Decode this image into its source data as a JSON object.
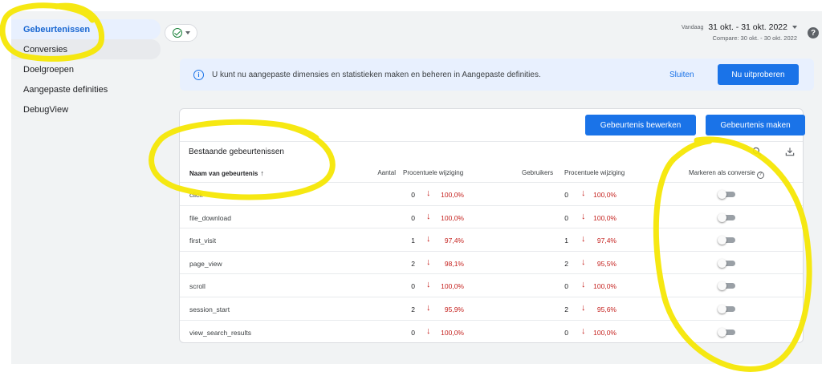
{
  "sidebar": {
    "items": [
      {
        "label": "Gebeurtenissen",
        "active": true
      },
      {
        "label": "Conversies"
      },
      {
        "label": "Doelgroepen"
      },
      {
        "label": "Aangepaste definities"
      },
      {
        "label": "DebugView"
      }
    ]
  },
  "header": {
    "status_icon": "check-circle-icon",
    "date_label": "Vandaag",
    "date_range": "31 okt. - 31 okt. 2022",
    "compare": "Compare: 30 okt. - 30 okt. 2022",
    "help": "?"
  },
  "banner": {
    "icon": "i",
    "text": "U kunt nu aangepaste dimensies en statistieken maken en beheren in Aangepaste definities.",
    "close_label": "Sluiten",
    "try_label": "Nu uitproberen"
  },
  "card": {
    "edit_label": "Gebeurtenis bewerken",
    "make_label": "Gebeurtenis maken",
    "title": "Bestaande gebeurtenissen"
  },
  "table": {
    "headers": {
      "name": "Naam van gebeurtenis",
      "sort_arrow": "↑",
      "count": "Aantal",
      "pct1": "Procentuele wijziging",
      "users": "Gebruikers",
      "pct2": "Procentuele wijziging",
      "conversion": "Markeren als conversie",
      "conversion_help": "?"
    },
    "down_arrow": "↓",
    "rows": [
      {
        "name": "click",
        "count": "0",
        "pct1": "100,0%",
        "users": "0",
        "pct2": "100,0%",
        "conversion": false
      },
      {
        "name": "file_download",
        "count": "0",
        "pct1": "100,0%",
        "users": "0",
        "pct2": "100,0%",
        "conversion": false
      },
      {
        "name": "first_visit",
        "count": "1",
        "pct1": "97,4%",
        "users": "1",
        "pct2": "97,4%",
        "conversion": false
      },
      {
        "name": "page_view",
        "count": "2",
        "pct1": "98,1%",
        "users": "2",
        "pct2": "95,5%",
        "conversion": false
      },
      {
        "name": "scroll",
        "count": "0",
        "pct1": "100,0%",
        "users": "0",
        "pct2": "100,0%",
        "conversion": false
      },
      {
        "name": "session_start",
        "count": "2",
        "pct1": "95,9%",
        "users": "2",
        "pct2": "95,6%",
        "conversion": false
      },
      {
        "name": "view_search_results",
        "count": "0",
        "pct1": "100,0%",
        "users": "0",
        "pct2": "100,0%",
        "conversion": false
      }
    ]
  },
  "colors": {
    "accent": "#1a73e8",
    "negative": "#c5221f",
    "highlighter": "#f5e600"
  }
}
